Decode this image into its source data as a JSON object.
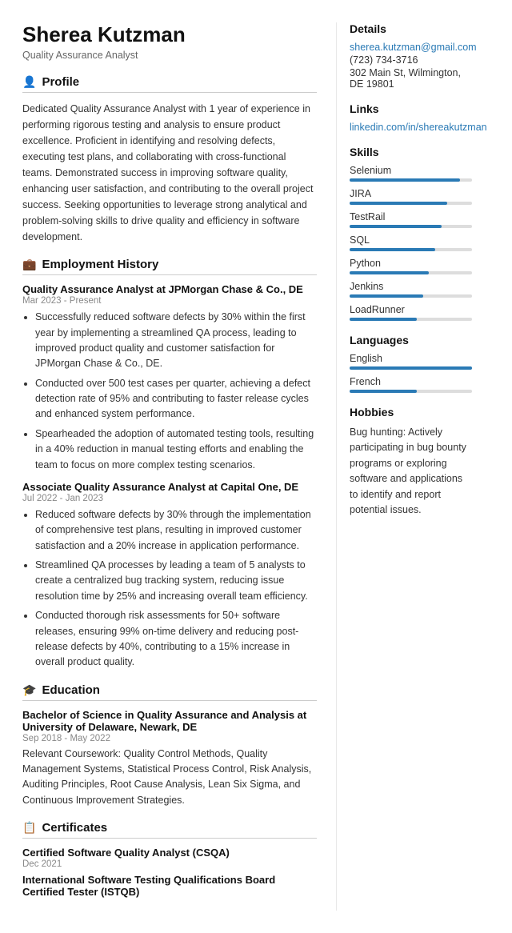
{
  "header": {
    "name": "Sherea Kutzman",
    "title": "Quality Assurance Analyst"
  },
  "sections": {
    "profile": {
      "label": "Profile",
      "icon": "👤",
      "text": "Dedicated Quality Assurance Analyst with 1 year of experience in performing rigorous testing and analysis to ensure product excellence. Proficient in identifying and resolving defects, executing test plans, and collaborating with cross-functional teams. Demonstrated success in improving software quality, enhancing user satisfaction, and contributing to the overall project success. Seeking opportunities to leverage strong analytical and problem-solving skills to drive quality and efficiency in software development."
    },
    "employment": {
      "label": "Employment History",
      "icon": "💼",
      "jobs": [
        {
          "title": "Quality Assurance Analyst at JPMorgan Chase & Co., DE",
          "date": "Mar 2023 - Present",
          "bullets": [
            "Successfully reduced software defects by 30% within the first year by implementing a streamlined QA process, leading to improved product quality and customer satisfaction for JPMorgan Chase & Co., DE.",
            "Conducted over 500 test cases per quarter, achieving a defect detection rate of 95% and contributing to faster release cycles and enhanced system performance.",
            "Spearheaded the adoption of automated testing tools, resulting in a 40% reduction in manual testing efforts and enabling the team to focus on more complex testing scenarios."
          ]
        },
        {
          "title": "Associate Quality Assurance Analyst at Capital One, DE",
          "date": "Jul 2022 - Jan 2023",
          "bullets": [
            "Reduced software defects by 30% through the implementation of comprehensive test plans, resulting in improved customer satisfaction and a 20% increase in application performance.",
            "Streamlined QA processes by leading a team of 5 analysts to create a centralized bug tracking system, reducing issue resolution time by 25% and increasing overall team efficiency.",
            "Conducted thorough risk assessments for 50+ software releases, ensuring 99% on-time delivery and reducing post-release defects by 40%, contributing to a 15% increase in overall product quality."
          ]
        }
      ]
    },
    "education": {
      "label": "Education",
      "icon": "🎓",
      "items": [
        {
          "title": "Bachelor of Science in Quality Assurance and Analysis at University of Delaware, Newark, DE",
          "date": "Sep 2018 - May 2022",
          "text": "Relevant Coursework: Quality Control Methods, Quality Management Systems, Statistical Process Control, Risk Analysis, Auditing Principles, Root Cause Analysis, Lean Six Sigma, and Continuous Improvement Strategies."
        }
      ]
    },
    "certificates": {
      "label": "Certificates",
      "icon": "📋",
      "items": [
        {
          "title": "Certified Software Quality Analyst (CSQA)",
          "date": "Dec 2021"
        },
        {
          "title": "International Software Testing Qualifications Board Certified Tester (ISTQB)",
          "date": ""
        }
      ]
    }
  },
  "sidebar": {
    "details": {
      "label": "Details",
      "email": "sherea.kutzman@gmail.com",
      "phone": "(723) 734-3716",
      "address": "302 Main St, Wilmington, DE 19801"
    },
    "links": {
      "label": "Links",
      "items": [
        {
          "text": "linkedin.com/in/shereakutzman",
          "url": "#"
        }
      ]
    },
    "skills": {
      "label": "Skills",
      "items": [
        {
          "name": "Selenium",
          "level": 90
        },
        {
          "name": "JIRA",
          "level": 80
        },
        {
          "name": "TestRail",
          "level": 75
        },
        {
          "name": "SQL",
          "level": 70
        },
        {
          "name": "Python",
          "level": 65
        },
        {
          "name": "Jenkins",
          "level": 60
        },
        {
          "name": "LoadRunner",
          "level": 55
        }
      ]
    },
    "languages": {
      "label": "Languages",
      "items": [
        {
          "name": "English",
          "level": 100
        },
        {
          "name": "French",
          "level": 55
        }
      ]
    },
    "hobbies": {
      "label": "Hobbies",
      "text": "Bug hunting: Actively participating in bug bounty programs or exploring software and applications to identify and report potential issues."
    }
  }
}
